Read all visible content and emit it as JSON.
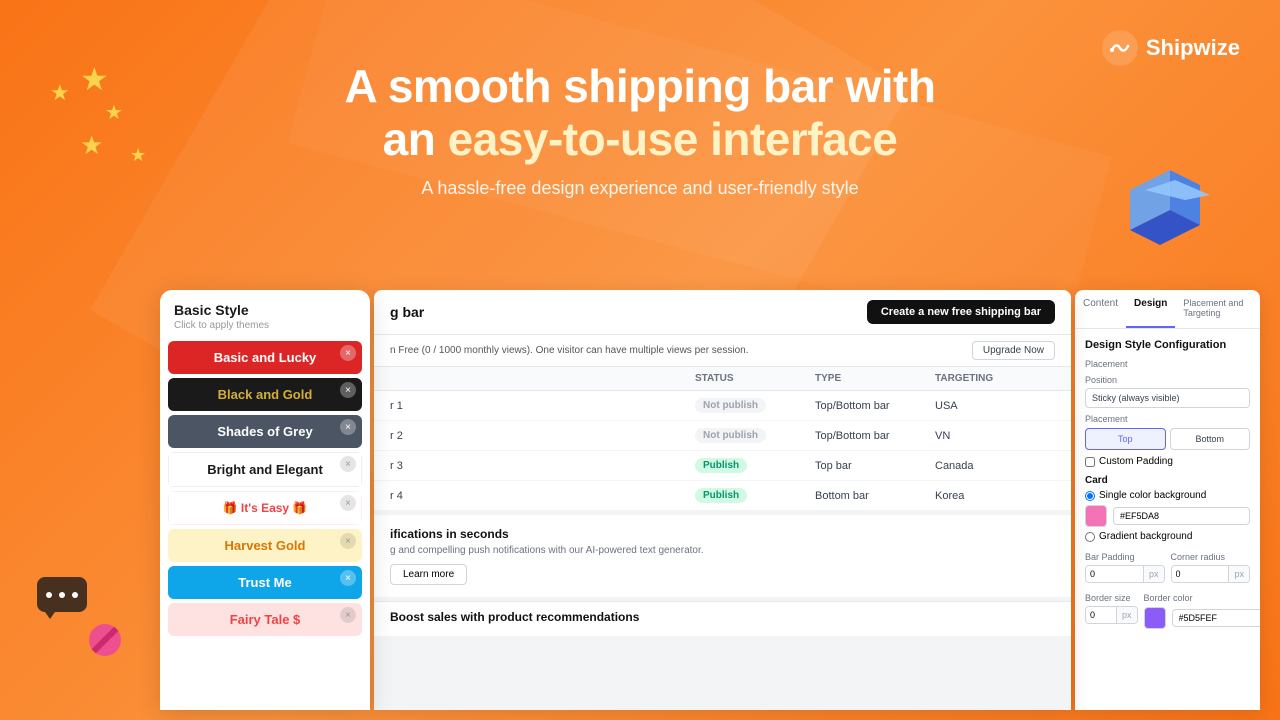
{
  "background": {
    "color": "#F97316"
  },
  "logo": {
    "text": "hipwize",
    "full": "Shipwize"
  },
  "hero": {
    "line1": "A smooth shipping bar with",
    "line2_plain": "an ",
    "line2_highlight": "easy-to-use interface",
    "subtitle": "A hassle-free design experience and user-friendly style"
  },
  "style_panel": {
    "title": "Basic Style",
    "subtitle": "Click to apply themes",
    "themes": [
      {
        "name": "Basic and Lucky",
        "css_class": "theme-basic",
        "closeable": true
      },
      {
        "name": "Black and Gold",
        "css_class": "theme-black-gold",
        "closeable": true
      },
      {
        "name": "Shades of Grey",
        "css_class": "theme-shades",
        "closeable": true
      },
      {
        "name": "Bright and Elegant",
        "css_class": "theme-bright",
        "closeable": true
      },
      {
        "name": "🎁 It's Easy 🎁",
        "css_class": "theme-easy",
        "closeable": true
      },
      {
        "name": "Harvest Gold",
        "css_class": "theme-harvest",
        "closeable": true
      },
      {
        "name": "Trust Me",
        "css_class": "theme-trust",
        "closeable": true
      },
      {
        "name": "Fairy Tale $",
        "css_class": "theme-fairy",
        "closeable": true
      }
    ]
  },
  "dashboard": {
    "page_title": "g bar",
    "notice": "n Free (0 / 1000 monthly views). One visitor can have multiple views per session.",
    "btn_create": "Create a new free shipping bar",
    "btn_upgrade": "Upgrade Now",
    "table_headers": [
      "",
      "Status",
      "Type",
      "Targeting"
    ],
    "rows": [
      {
        "name": "r 1",
        "status": "Not publish",
        "status_class": "badge-notpublish",
        "type": "Top/Bottom bar",
        "targeting": "USA"
      },
      {
        "name": "r 2",
        "status": "Not publish",
        "status_class": "badge-notpublish",
        "type": "Top/Bottom bar",
        "targeting": "VN"
      },
      {
        "name": "r 3",
        "status": "Publish",
        "status_class": "badge-publish",
        "type": "Top bar",
        "targeting": "Canada"
      },
      {
        "name": "r 4",
        "status": "Publish",
        "status_class": "badge-publish",
        "type": "Bottom bar",
        "targeting": "Korea"
      }
    ],
    "bottom_section": {
      "title": "ifications in seconds",
      "desc": "g and compelling push notifications with our AI-powered text generator.",
      "btn_learn": "Learn more",
      "boost_title": "Boost sales with product recommendations"
    }
  },
  "design_panel": {
    "tabs": [
      "Content",
      "Design",
      "Placement and Targeting"
    ],
    "active_tab": "Design",
    "section_title": "Design Style Configuration",
    "placement": {
      "label": "Placement",
      "position_label": "Position",
      "position_value": "Sticky (always visible)",
      "placement_label": "Placement",
      "top_label": "Top",
      "bottom_label": "Bottom",
      "custom_padding_label": "Custom Padding"
    },
    "card": {
      "label": "Card",
      "single_color_label": "Single color background",
      "color_value": "#EF5DA8",
      "gradient_label": "Gradient background"
    },
    "bar_padding": {
      "label": "Bar Padding",
      "value": "0",
      "unit": "px"
    },
    "corner_radius": {
      "label": "Corner radius",
      "value": "0",
      "unit": "px"
    },
    "border_size": {
      "label": "Border size",
      "value": "0",
      "unit": "px"
    },
    "border_color": {
      "label": "Border color",
      "value": "#5D5FEF"
    }
  },
  "stars": [
    "★",
    "★",
    "★",
    "★",
    "★"
  ]
}
